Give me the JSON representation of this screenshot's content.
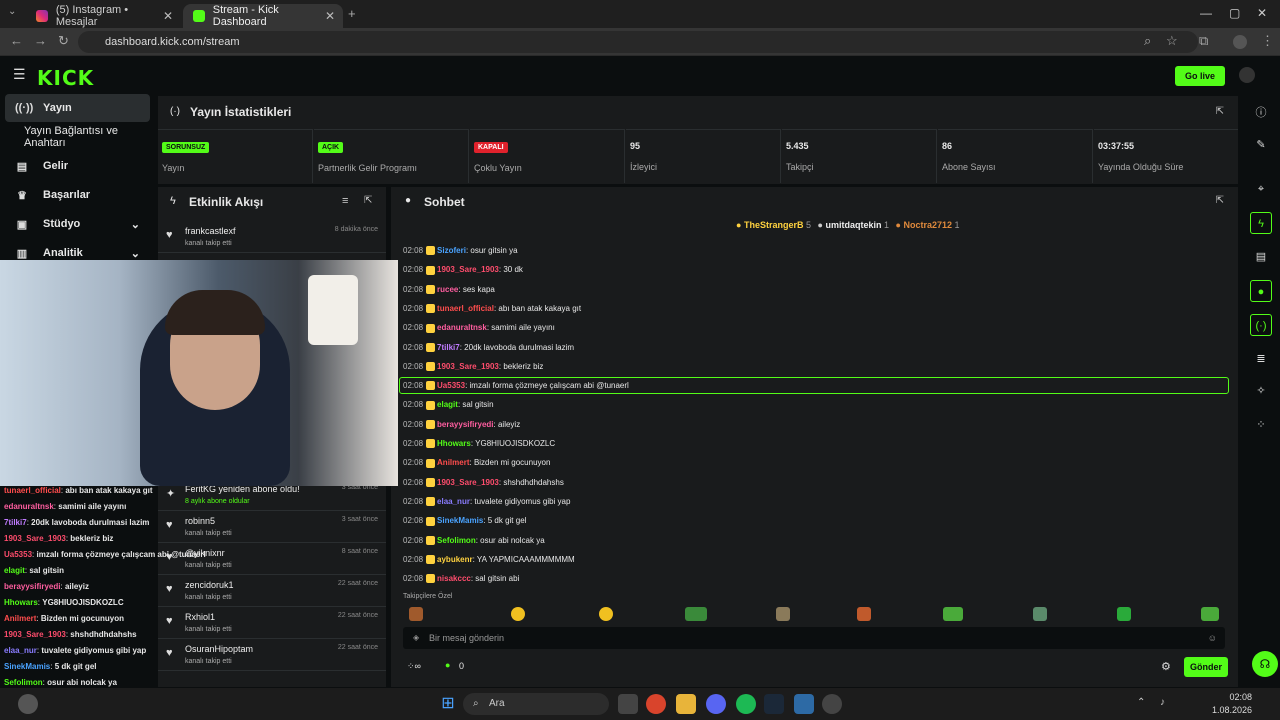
{
  "browser": {
    "tabs": [
      {
        "label": "(5) Instagram • Mesajlar",
        "active": false
      },
      {
        "label": "Stream - Kick Dashboard",
        "active": true
      }
    ],
    "url": "dashboard.kick.com/stream"
  },
  "kick": {
    "logo": "KICK",
    "go_live": "Go live",
    "sidebar": [
      {
        "label": "Yayın",
        "icon": "broadcast-icon",
        "active": true
      },
      {
        "label": "Yayın Bağlantısı ve Anahtarı",
        "icon": "",
        "active": false
      },
      {
        "label": "Gelir",
        "icon": "money-icon",
        "active": false
      },
      {
        "label": "Başarılar",
        "icon": "trophy-icon",
        "active": false
      },
      {
        "label": "Stüdyo",
        "icon": "studio-icon",
        "active": false
      },
      {
        "label": "Analitik",
        "icon": "chart-icon",
        "active": false
      }
    ],
    "stats": {
      "title": "Yayın İstatistikleri",
      "items": [
        {
          "value": "SORUNSUZ",
          "label": "Yayın",
          "badge": true,
          "color": "#53fc18"
        },
        {
          "value": "AÇIK",
          "label": "Partnerlik Gelir Programı",
          "badge": true,
          "color": "#53fc18"
        },
        {
          "value": "KAPALI",
          "label": "Çoklu Yayın",
          "badge": true,
          "color": "#e0222c"
        },
        {
          "value": "95",
          "label": "İzleyici",
          "badge": false
        },
        {
          "value": "5.435",
          "label": "Takipçi",
          "badge": false
        },
        {
          "value": "86",
          "label": "Abone Sayısı",
          "badge": false
        },
        {
          "value": "03:37:55",
          "label": "Yayında Olduğu Süre",
          "badge": false
        }
      ]
    },
    "activity": {
      "title": "Etkinlik Akışı",
      "items": [
        {
          "name": "frankcastlexf",
          "sub": "kanalı takip etti",
          "time": "8 dakika önce",
          "icon": "heart-icon"
        },
        {
          "name": "FeritKG yeniden abone oldu!",
          "sub": "8 aylık abone oldular",
          "time": "3 saat önce",
          "icon": "star-icon"
        },
        {
          "name": "robinn5",
          "sub": "kanalı takip etti",
          "time": "3 saat önce",
          "icon": "heart-icon"
        },
        {
          "name": "@yiknixnr",
          "sub": "kanalı takip etti",
          "time": "8 saat önce",
          "icon": "heart-icon"
        },
        {
          "name": "zencidoruk1",
          "sub": "kanalı takip etti",
          "time": "22 saat önce",
          "icon": "heart-icon"
        },
        {
          "name": "Rxhiol1",
          "sub": "kanalı takip etti",
          "time": "22 saat önce",
          "icon": "heart-icon"
        },
        {
          "name": "OsuranHipoptam",
          "sub": "kanalı takip etti",
          "time": "22 saat önce",
          "icon": "heart-icon"
        }
      ]
    },
    "chat": {
      "title": "Sohbet",
      "top_gifters": [
        {
          "name": "TheStrangerB",
          "count": "5"
        },
        {
          "name": "umitdaqtekin",
          "count": "1"
        },
        {
          "name": "Noctra2712",
          "count": "1"
        }
      ],
      "messages": [
        {
          "time": "02:08",
          "user": "Sizoferi",
          "color": "#4aa3ff",
          "text": "osur gitsin ya"
        },
        {
          "time": "02:08",
          "user": "1903_Sare_1903",
          "color": "#ff4d6d",
          "text": "30 dk"
        },
        {
          "time": "02:08",
          "user": "rucee",
          "color": "#ff5ea0",
          "text": "ses kapa"
        },
        {
          "time": "02:08",
          "user": "tunaerl_official",
          "color": "#ff4d4d",
          "text": "abı ban atak kakaya gıt"
        },
        {
          "time": "02:08",
          "user": "edanuraltnsk",
          "color": "#ff5ea0",
          "text": "samimi aile yayını"
        },
        {
          "time": "02:08",
          "user": "7tilki7",
          "color": "#c07cff",
          "text": "20dk lavoboda durulmasi lazim"
        },
        {
          "time": "02:08",
          "user": "1903_Sare_1903",
          "color": "#ff4d6d",
          "text": "bekleriz biz"
        },
        {
          "time": "02:08",
          "user": "Ua5353",
          "color": "#ff4d6d",
          "text": "imzalı forma çözmeye çalışcam abi @tunaerl"
        },
        {
          "time": "02:08",
          "user": "elagit",
          "color": "#53fc18",
          "text": "sal gitsin"
        },
        {
          "time": "02:08",
          "user": "berayysifiryedi",
          "color": "#ff5ea0",
          "text": "aileyiz"
        },
        {
          "time": "02:08",
          "user": "Hhowars",
          "color": "#53fc18",
          "text": "YG8HIUOJISDKOZLC"
        },
        {
          "time": "02:08",
          "user": "Anilmert",
          "color": "#ff4d4d",
          "text": "Bizden mi gocunuyon"
        },
        {
          "time": "02:08",
          "user": "1903_Sare_1903",
          "color": "#ff4d6d",
          "text": "shshdhdhdahshs"
        },
        {
          "time": "02:08",
          "user": "elaa_nur",
          "color": "#8a7cff",
          "text": "tuvalete gidiyomus gibi yap"
        },
        {
          "time": "02:08",
          "user": "SinekMamis",
          "color": "#4aa3ff",
          "text": "5 dk git gel"
        },
        {
          "time": "02:08",
          "user": "Sefolimon",
          "color": "#53fc18",
          "text": "osur abi nolcak ya"
        },
        {
          "time": "02:08",
          "user": "aybukenr",
          "color": "#ffd23f",
          "text": "YA YAPMICAAAMMMMMM"
        },
        {
          "time": "02:08",
          "user": "nisakccc",
          "color": "#ff4d6d",
          "text": "sal gitsin abi"
        }
      ],
      "emote_section": "Takipçilere Özel",
      "input_placeholder": "Bir mesaj gönderin",
      "points": "0",
      "send_label": "Gönder"
    },
    "overlay_chat": [
      {
        "user": "tunaerl_official",
        "text": "abı ban atak kakaya gıt",
        "color": "#ff4d4d"
      },
      {
        "user": "edanuraltnsk",
        "text": "samimi aile yayını",
        "color": "#ff5ea0"
      },
      {
        "user": "7tilki7",
        "text": "20dk lavoboda durulmasi lazim",
        "color": "#c07cff"
      },
      {
        "user": "1903_Sare_1903",
        "text": "bekleriz biz",
        "color": "#ff4d6d"
      },
      {
        "user": "Ua5353",
        "text": "imzalı forma çözmeye çalışcam abi @tunaerl",
        "color": "#ff4d6d"
      },
      {
        "user": "elagit",
        "text": "sal gitsin",
        "color": "#53fc18"
      },
      {
        "user": "berayysifiryedi",
        "text": "aileyiz",
        "color": "#ff5ea0"
      },
      {
        "user": "Hhowars",
        "text": "YG8HIUOJISDKOZLC",
        "color": "#53fc18"
      },
      {
        "user": "Anilmert",
        "text": "Bizden mi gocunuyon",
        "color": "#ff4d4d"
      },
      {
        "user": "1903_Sare_1903",
        "text": "shshdhdhdahshs",
        "color": "#ff4d6d"
      },
      {
        "user": "elaa_nur",
        "text": "tuvalete gidiyomus gibi yap",
        "color": "#8a7cff"
      },
      {
        "user": "SinekMamis",
        "text": "5 dk git gel",
        "color": "#4aa3ff"
      },
      {
        "user": "Sefolimon",
        "text": "osur abi nolcak ya",
        "color": "#53fc18"
      },
      {
        "user": "aybukenr",
        "text": "YA YAPMİCAAAMMMMMMM",
        "color": "#ffd23f"
      },
      {
        "user": "nisakccc",
        "text": "sal gitsin abi",
        "color": "#ff4d6d"
      }
    ]
  },
  "taskbar": {
    "search": "Ara",
    "time": "02:08",
    "date": "1.08.2026"
  }
}
